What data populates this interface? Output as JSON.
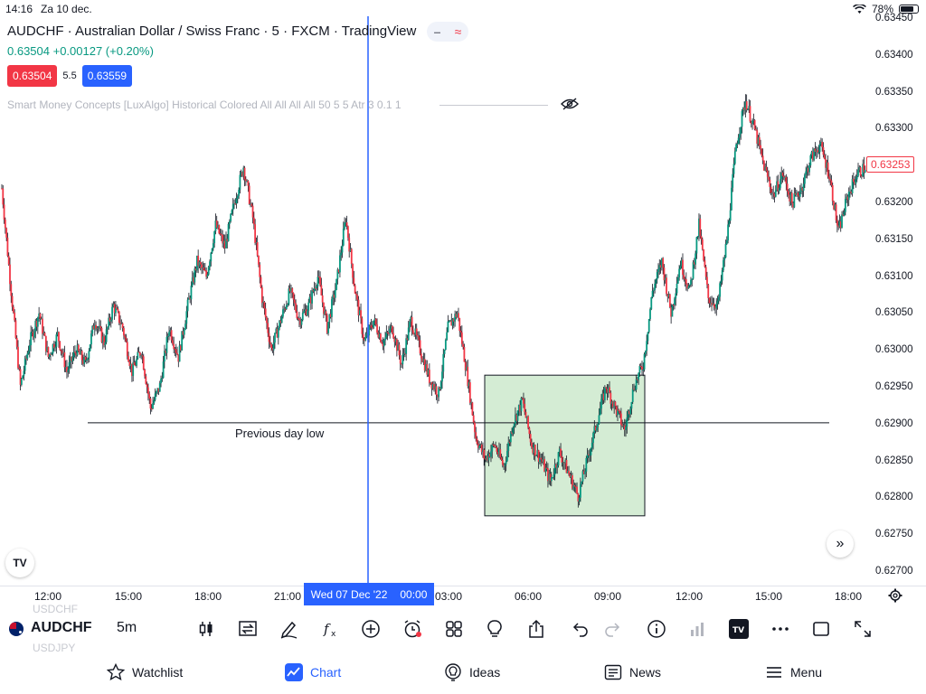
{
  "status_bar": {
    "time": "14:16",
    "date": "Za 10 dec.",
    "battery": "78%",
    "icons": [
      "wifi-icon",
      "battery-icon"
    ]
  },
  "legend": {
    "title": "AUDCHF · Australian Dollar / Swiss Franc · 5 · FXCM · TradingView",
    "change": "0.63504 +0.00127 (+0.20%)",
    "sell_price": "0.63504",
    "spread": "5.5",
    "buy_price": "0.63559",
    "indicator": "Smart Money Concepts [LuxAlgo] Historical Colored All All All All 50 5 5 Atr 3 0.1 1"
  },
  "chart_data": {
    "type": "candlestick",
    "symbol": "AUDCHF",
    "interval": "5m",
    "ylim": [
      0.6268,
      0.6346
    ],
    "y_ticks": [
      "0.63450",
      "0.63400",
      "0.63350",
      "0.63300",
      "0.63250",
      "0.63200",
      "0.63150",
      "0.63100",
      "0.63050",
      "0.63000",
      "0.62950",
      "0.62900",
      "0.62850",
      "0.62800",
      "0.62750",
      "0.62700"
    ],
    "x_ticks": [
      "12:00",
      "15:00",
      "18:00",
      "21:00",
      "03:00",
      "06:00",
      "09:00",
      "12:00",
      "15:00",
      "18:00"
    ],
    "last_price": "0.63253",
    "crosshair_label_date": "Wed 07 Dec '22",
    "crosshair_label_time": "00:00",
    "path_points": [
      0.6322,
      0.6308,
      0.6295,
      0.6301,
      0.6305,
      0.6299,
      0.6302,
      0.6297,
      0.63,
      0.6298,
      0.6304,
      0.6301,
      0.6306,
      0.6303,
      0.6297,
      0.63,
      0.6292,
      0.6295,
      0.6303,
      0.6299,
      0.6306,
      0.6312,
      0.631,
      0.6317,
      0.6314,
      0.632,
      0.6325,
      0.6318,
      0.6307,
      0.63,
      0.6304,
      0.6308,
      0.6304,
      0.6306,
      0.631,
      0.6303,
      0.6309,
      0.6318,
      0.6308,
      0.6301,
      0.6304,
      0.6301,
      0.6303,
      0.6298,
      0.6304,
      0.63,
      0.6296,
      0.6294,
      0.6303,
      0.6305,
      0.6297,
      0.6288,
      0.6285,
      0.6287,
      0.6284,
      0.629,
      0.6293,
      0.6287,
      0.6285,
      0.6282,
      0.6286,
      0.6283,
      0.628,
      0.6285,
      0.629,
      0.6295,
      0.6292,
      0.6289,
      0.6295,
      0.6298,
      0.6308,
      0.6312,
      0.6305,
      0.6312,
      0.6308,
      0.6317,
      0.6307,
      0.6306,
      0.6315,
      0.6328,
      0.6334,
      0.633,
      0.6325,
      0.6321,
      0.6324,
      0.632,
      0.6322,
      0.6326,
      0.6328,
      0.6324,
      0.6316,
      0.6321,
      0.6324,
      0.6325
    ],
    "annotations": {
      "horizontal_line": {
        "price": 0.629,
        "label": "Previous day low"
      },
      "box": {
        "price_top": 0.62965,
        "price_bottom": 0.62773,
        "fill": "#d4ecd4"
      },
      "vertical_line_color": "#2962ff"
    },
    "colors": {
      "up": "#089981",
      "down": "#f23645",
      "wick": "#131722"
    }
  },
  "time_axis": {
    "labels": [
      "12:00",
      "15:00",
      "18:00",
      "21:00",
      "03:00",
      "06:00",
      "09:00",
      "12:00",
      "15:00",
      "18:00"
    ]
  },
  "toolbar": {
    "symbol_ghost_top": "USDCHF",
    "symbol": "AUDCHF",
    "symbol_ghost_bottom": "USDJPY",
    "interval": "5m",
    "icons": [
      "candles-icon",
      "replay-icon",
      "draw-icon",
      "indicators-icon",
      "add-icon",
      "alert-icon",
      "layouts-icon",
      "ideas-icon",
      "share-icon",
      "undo-icon",
      "redo-icon",
      "info-icon",
      "volume-icon",
      "tradingview-icon",
      "more-icon",
      "fullscreen-square-icon",
      "expand-icon"
    ]
  },
  "bottom_nav": {
    "items": [
      {
        "label": "Watchlist",
        "icon": "star-icon"
      },
      {
        "label": "Chart",
        "icon": "chart-icon",
        "active": true
      },
      {
        "label": "Ideas",
        "icon": "lightbulb-icon"
      },
      {
        "label": "News",
        "icon": "news-icon"
      },
      {
        "label": "Menu",
        "icon": "menu-icon"
      }
    ]
  }
}
